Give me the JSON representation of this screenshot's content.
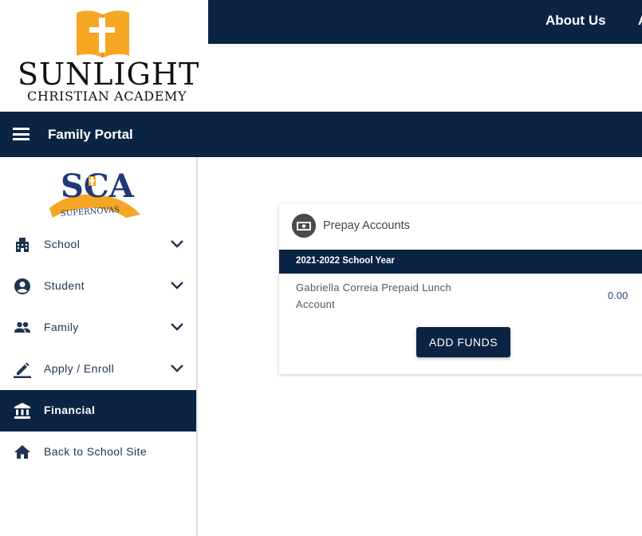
{
  "logo": {
    "name_main": "SUNLIGHT",
    "name_sub": "CHRISTIAN ACADEMY"
  },
  "topnav": {
    "items": [
      {
        "label": "About Us"
      },
      {
        "label": "A"
      }
    ]
  },
  "portal": {
    "title": "Family Portal"
  },
  "sidebar": {
    "logo_text": "SCA",
    "logo_banner": "SUPERNOVAS",
    "items": [
      {
        "label": "School",
        "icon": "building-icon",
        "expandable": true
      },
      {
        "label": "Student",
        "icon": "account-circle-icon",
        "expandable": true
      },
      {
        "label": "Family",
        "icon": "people-icon",
        "expandable": true
      },
      {
        "label": "Apply / Enroll",
        "icon": "pencil-icon",
        "expandable": true
      },
      {
        "label": "Financial",
        "icon": "bank-icon",
        "expandable": false,
        "active": true
      },
      {
        "label": "Back to School Site",
        "icon": "home-icon",
        "expandable": false
      }
    ]
  },
  "card": {
    "title": "Prepay Accounts",
    "icon": "money-icon",
    "year_label": "2021-2022 School Year",
    "account": {
      "name": "Gabriella Correia Prepaid Lunch Account",
      "amount": "0.00"
    },
    "button_label": "ADD FUNDS"
  },
  "colors": {
    "navy": "#0c2444",
    "logo_gold": "#f5a623",
    "white": "#ffffff"
  }
}
